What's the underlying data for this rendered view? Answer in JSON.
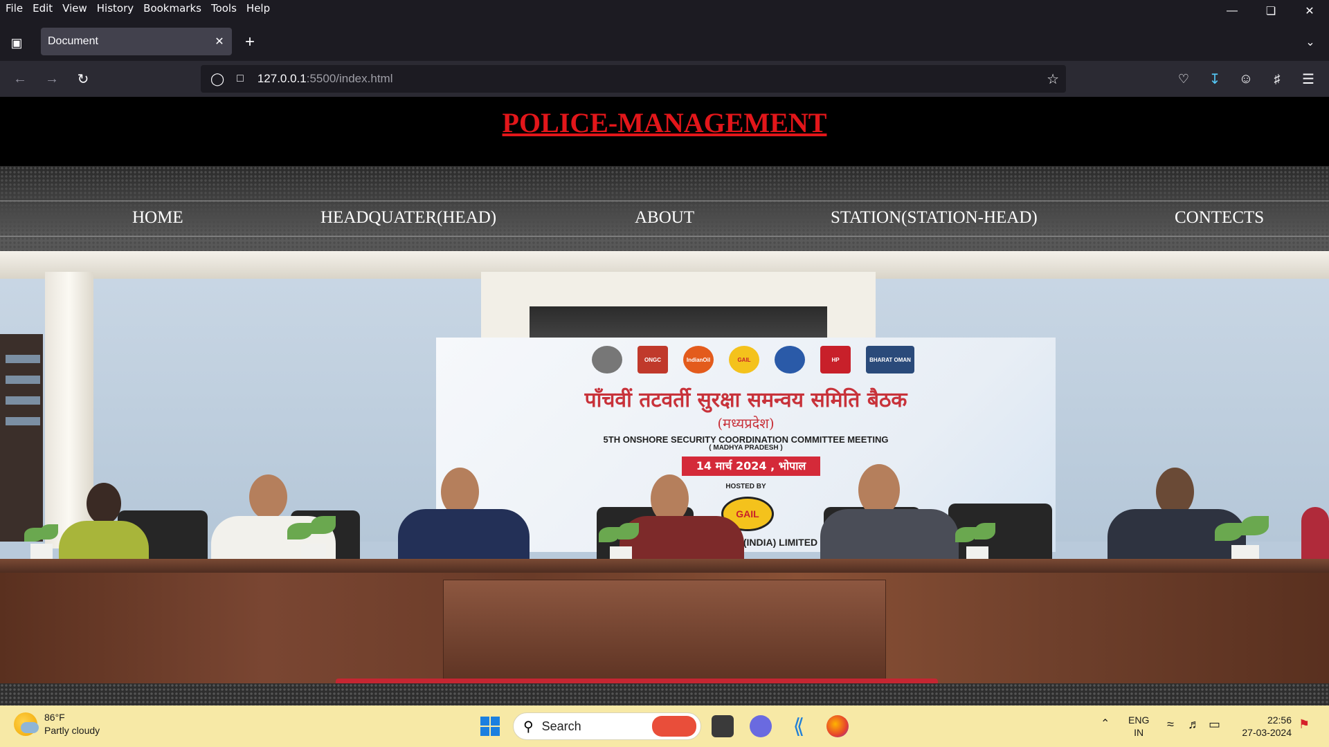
{
  "browser": {
    "menu": [
      "File",
      "Edit",
      "View",
      "History",
      "Bookmarks",
      "Tools",
      "Help"
    ],
    "tab_title": "Document",
    "url_host": "127.0.0.1",
    "url_rest": ":5500/index.html"
  },
  "page": {
    "title": "POLICE-MANAGEMENT",
    "nav": [
      "HOME",
      "HEADQUATER(HEAD)",
      "ABOUT",
      "STATION(STATION-HEAD)",
      "CONTECTS"
    ],
    "hero": {
      "banner_hindi_title": "पाँचवीं तटवर्ती सुरक्षा समन्वय समिति बैठक",
      "banner_hindi_sub": "(मध्यप्रदेश)",
      "banner_english": "5TH ONSHORE SECURITY COORDINATION COMMITTEE MEETING",
      "banner_english_sub": "( MADHYA PRADESH )",
      "date": "14 मार्च 2024 , भोपाल",
      "hosted_by": "HOSTED BY",
      "host": "(INDIA) LIMITED",
      "logo_labels": [
        "ONGC",
        "IndianOil",
        "GAIL",
        "HP",
        "BHARAT OMAN"
      ]
    }
  },
  "taskbar": {
    "temperature": "86°F",
    "weather": "Partly cloudy",
    "search": "Search",
    "lang": "ENG",
    "region": "IN",
    "time": "22:56",
    "date": "27-03-2024"
  },
  "colors": {
    "title_red": "#e2161a",
    "taskbar_bg": "#f7e9a6",
    "browser_bg": "#1c1b22"
  }
}
